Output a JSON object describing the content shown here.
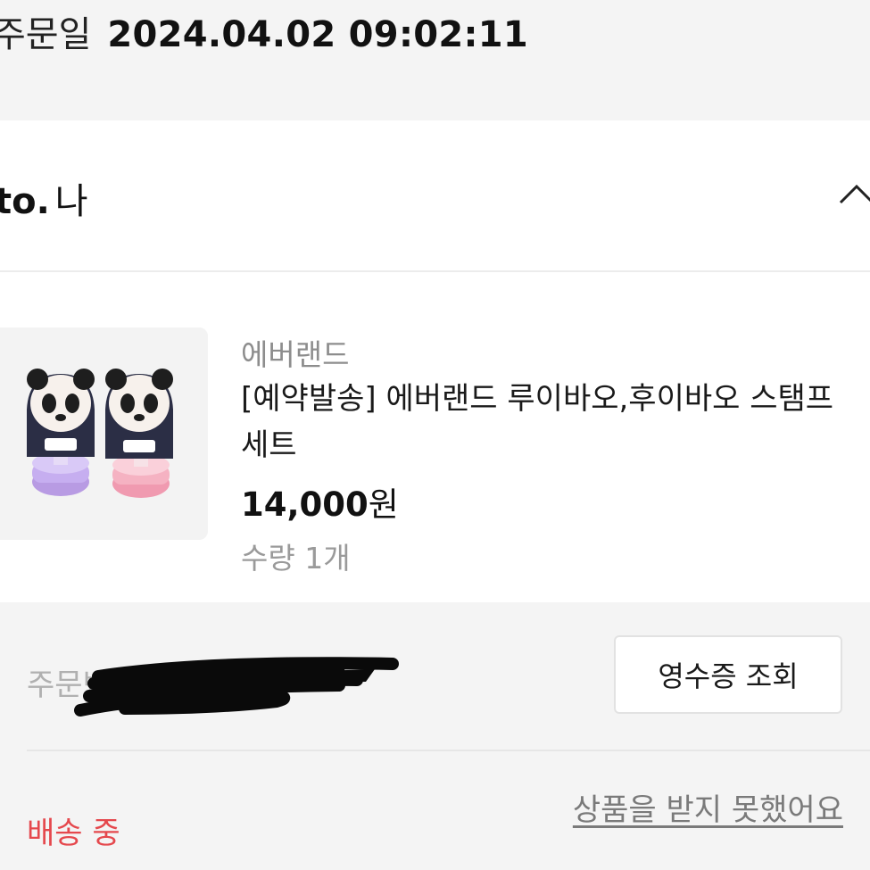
{
  "order": {
    "date_label": "주문일",
    "date_value": "2024.04.02 09:02:11",
    "number_label": "주문번호",
    "status": "배송 중"
  },
  "recipient": {
    "prefix": "to.",
    "name": "나",
    "toggle_icon": "chevron-up-icon"
  },
  "product": {
    "brand": "에버랜드",
    "name": "[예약발송] 에버랜드 루이바오,후이바오 스탬프 세트",
    "price": "14,000",
    "price_unit": "원",
    "quantity": "수량 1개",
    "image": "panda-stamp-set"
  },
  "actions": {
    "receipt_label": "영수증 조회",
    "not_received_label": "상품을 받지 못했어요"
  },
  "colors": {
    "status": "#e5484d",
    "background": "#f4f4f4"
  }
}
